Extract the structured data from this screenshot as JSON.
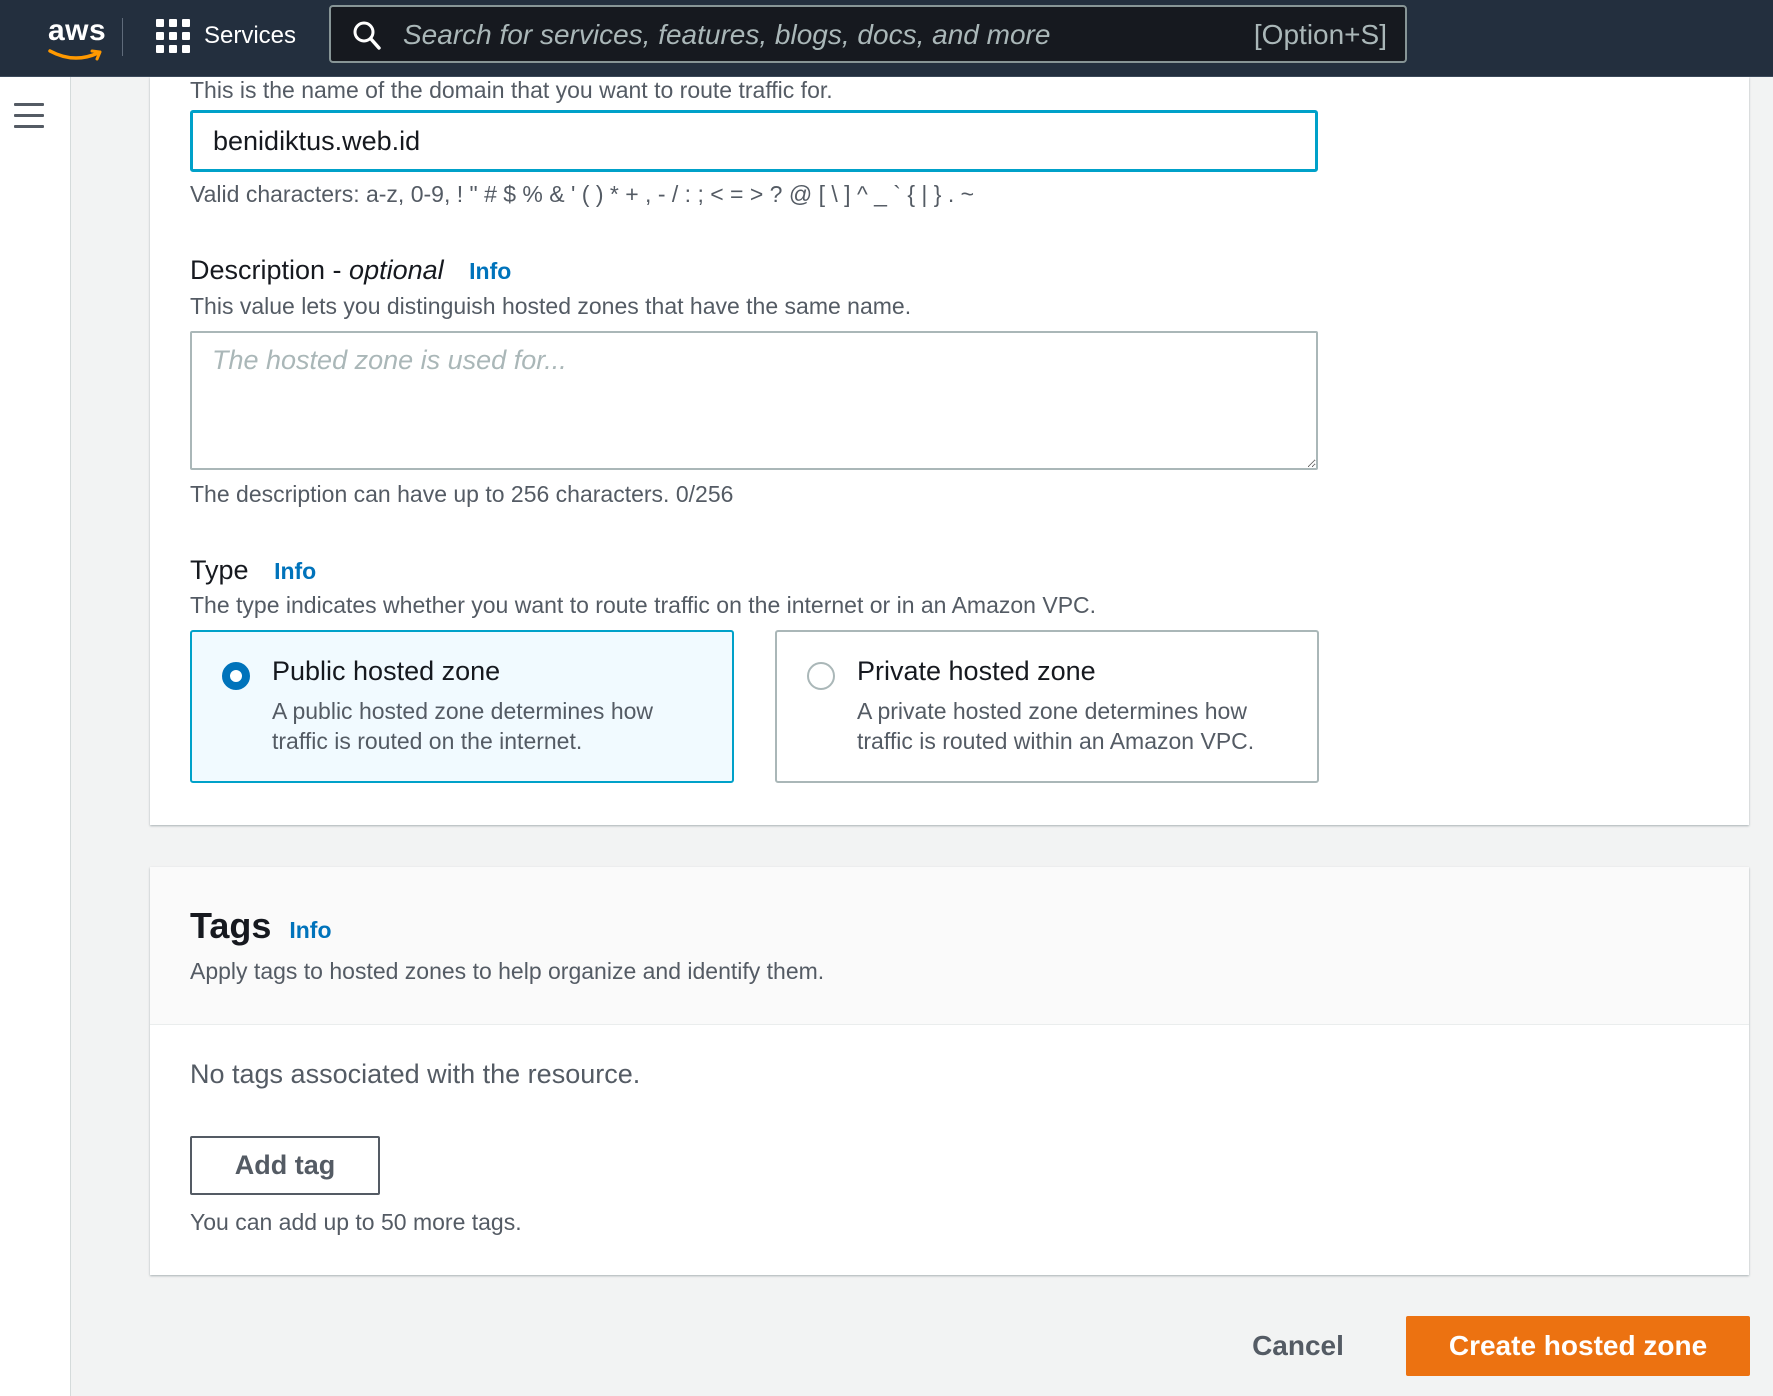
{
  "nav": {
    "logo_text": "aws",
    "services_label": "Services",
    "search_placeholder": "Search for services, features, blogs, docs, and more",
    "search_shortcut": "[Option+S]"
  },
  "domain": {
    "hint": "This is the name of the domain that you want to route traffic for.",
    "value": "benidiktus.web.id",
    "valid_chars": "Valid characters: a-z, 0-9, ! \" # $ % & ' ( ) * + , - / : ; < = > ? @ [ \\ ] ^ _ ` { | } . ~"
  },
  "description": {
    "label": "Description - ",
    "label_optional": "optional",
    "info": "Info",
    "hint": "This value lets you distinguish hosted zones that have the same name.",
    "placeholder": "The hosted zone is used for...",
    "constraint": "The description can have up to 256 characters. 0/256"
  },
  "type": {
    "label": "Type",
    "info": "Info",
    "hint": "The type indicates whether you want to route traffic on the internet or in an Amazon VPC.",
    "options": [
      {
        "title": "Public hosted zone",
        "description": "A public hosted zone determines how traffic is routed on the internet.",
        "selected": true
      },
      {
        "title": "Private hosted zone",
        "description": "A private hosted zone determines how traffic is routed within an Amazon VPC.",
        "selected": false
      }
    ]
  },
  "tags": {
    "title": "Tags",
    "info": "Info",
    "subtitle": "Apply tags to hosted zones to help organize and identify them.",
    "empty": "No tags associated with the resource.",
    "add_label": "Add tag",
    "limit": "You can add up to 50 more tags."
  },
  "actions": {
    "cancel": "Cancel",
    "create": "Create hosted zone"
  },
  "colors": {
    "nav_bg": "#232f3e",
    "accent": "#ec7211",
    "link": "#0073bb",
    "focus": "#00a1c9"
  }
}
